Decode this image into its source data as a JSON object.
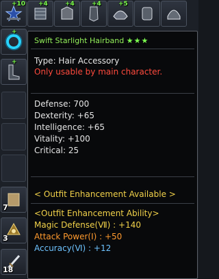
{
  "top_slots": [
    {
      "name": "starlight-slot-1",
      "plus": "+10",
      "qty": ""
    },
    {
      "name": "starlight-slot-2",
      "plus": "+4",
      "qty": ""
    },
    {
      "name": "starlight-slot-3",
      "plus": "+4",
      "qty": ""
    },
    {
      "name": "starlight-slot-4",
      "plus": "+4",
      "qty": ""
    },
    {
      "name": "starlight-slot-5",
      "plus": "+5",
      "qty": ""
    }
  ],
  "left_slots": [
    {
      "name": "ring-slot",
      "plus": "+",
      "qty": ""
    },
    {
      "name": "boots-slot",
      "plus": "+",
      "qty": ""
    },
    {
      "name": "empty-slot-1",
      "qty": ""
    },
    {
      "name": "empty-slot-2",
      "qty": ""
    },
    {
      "name": "empty-slot-3",
      "qty": ""
    },
    {
      "name": "scroll-slot",
      "qty": "7"
    },
    {
      "name": "helmet-slot",
      "qty": "3"
    },
    {
      "name": "sword-slot",
      "qty": "18"
    }
  ],
  "tooltip": {
    "title": "Swift Starlight Hairband",
    "stars": "★★★",
    "type": "Type: Hair Accessory",
    "restriction": "Only usable by main character.",
    "stats": [
      "Defense: 700",
      "Dexterity: +65",
      "Intelligence: +65",
      "Vitality: +100",
      "Critical: 25"
    ],
    "outfit_available": "< Outfit Enhancement Available >",
    "outfit_ability_header": "<Outfit Enhancement Ability>",
    "outfit_ability_lines": [
      {
        "text": "Magic Defense(Ⅶ) : +140",
        "color": "#f2d24a"
      },
      {
        "text": "Attack Power(Ⅰ) : +50",
        "color": "#ff9a2e"
      },
      {
        "text": "Accuracy(Ⅵ) : +12",
        "color": "#6ec3ff"
      }
    ]
  },
  "colors": {
    "title": "#93f05a",
    "restriction": "#ff4a3d",
    "stat": "#e6e6e6",
    "gold": "#f2d24a",
    "enhance_plus": "#7dff4f"
  }
}
